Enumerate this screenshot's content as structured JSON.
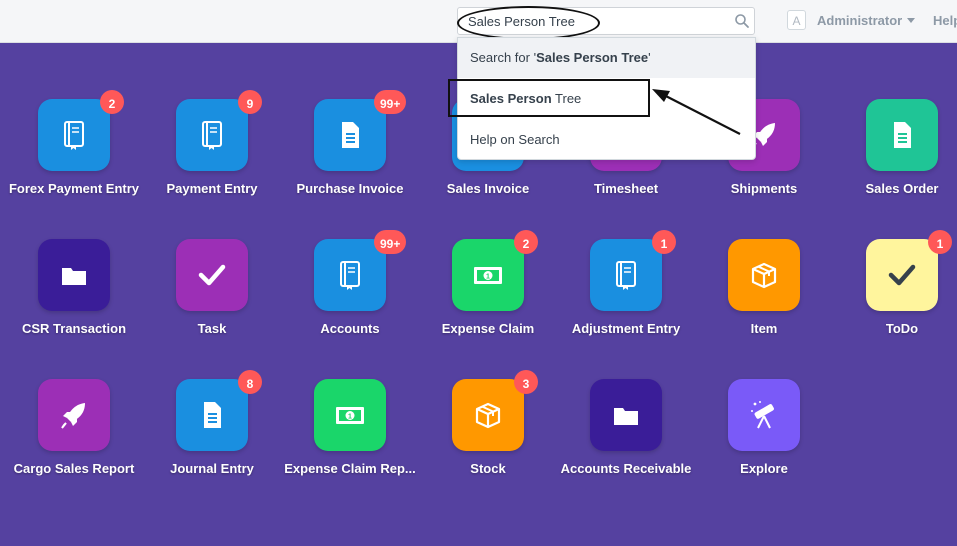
{
  "navbar": {
    "search": {
      "value": "Sales Person Tree",
      "placeholder": ""
    },
    "avatar_letter": "A",
    "user_label": "Administrator",
    "help_label": "Help"
  },
  "dropdown": {
    "item1": {
      "prefix": "Search for '",
      "bold": "Sales Person Tree",
      "suffix": "'"
    },
    "item2": {
      "bold": "Sales Person",
      "rest": " Tree"
    },
    "item3": {
      "label": "Help on Search"
    }
  },
  "colors": {
    "background": "#5541a0",
    "blue": "#1a8fe0",
    "purple": "#9c2fb6",
    "teal": "#1fc596",
    "indigo": "#3a1d98",
    "green": "#1ad66a",
    "orange": "#ff9800",
    "yellow": "#fff59d",
    "violet": "#7a5af8",
    "badge": "#ff5858"
  },
  "modules": [
    {
      "label": "Forex Payment Entry",
      "icon": "book-icon",
      "color": "#1a8fe0",
      "badge": "2"
    },
    {
      "label": "Payment Entry",
      "icon": "book-icon",
      "color": "#1a8fe0",
      "badge": "9"
    },
    {
      "label": "Purchase Invoice",
      "icon": "file-icon",
      "color": "#1a8fe0",
      "badge": "99+"
    },
    {
      "label": "Sales Invoice",
      "icon": "file-icon",
      "color": "#1a8fe0",
      "badge": ""
    },
    {
      "label": "Timesheet",
      "icon": "clock-icon",
      "color": "#9c2fb6",
      "badge": ""
    },
    {
      "label": "Shipments",
      "icon": "rocket-icon",
      "color": "#9c2fb6",
      "badge": ""
    },
    {
      "label": "Sales Order",
      "icon": "file-icon",
      "color": "#1fc596",
      "badge": ""
    },
    {
      "label": "CSR Transaction",
      "icon": "folder-icon",
      "color": "#3a1d98",
      "badge": ""
    },
    {
      "label": "Task",
      "icon": "check-icon",
      "color": "#9c2fb6",
      "badge": ""
    },
    {
      "label": "Accounts",
      "icon": "book-icon",
      "color": "#1a8fe0",
      "badge": "99+"
    },
    {
      "label": "Expense Claim",
      "icon": "money-icon",
      "color": "#1ad66a",
      "badge": "2"
    },
    {
      "label": "Adjustment Entry",
      "icon": "book-icon",
      "color": "#1a8fe0",
      "badge": "1"
    },
    {
      "label": "Item",
      "icon": "box-icon",
      "color": "#ff9800",
      "badge": ""
    },
    {
      "label": "ToDo",
      "icon": "check-icon",
      "color": "#fff59d",
      "badge": "1"
    },
    {
      "label": "Cargo Sales Report",
      "icon": "rocket-icon",
      "color": "#9c2fb6",
      "badge": ""
    },
    {
      "label": "Journal Entry",
      "icon": "file-icon",
      "color": "#1a8fe0",
      "badge": "8"
    },
    {
      "label": "Expense Claim Rep...",
      "icon": "money-icon",
      "color": "#1ad66a",
      "badge": ""
    },
    {
      "label": "Stock",
      "icon": "box-icon",
      "color": "#ff9800",
      "badge": "3"
    },
    {
      "label": "Accounts Receivable",
      "icon": "folder-icon",
      "color": "#3a1d98",
      "badge": ""
    },
    {
      "label": "Explore",
      "icon": "telescope-icon",
      "color": "#7a5af8",
      "badge": ""
    }
  ]
}
